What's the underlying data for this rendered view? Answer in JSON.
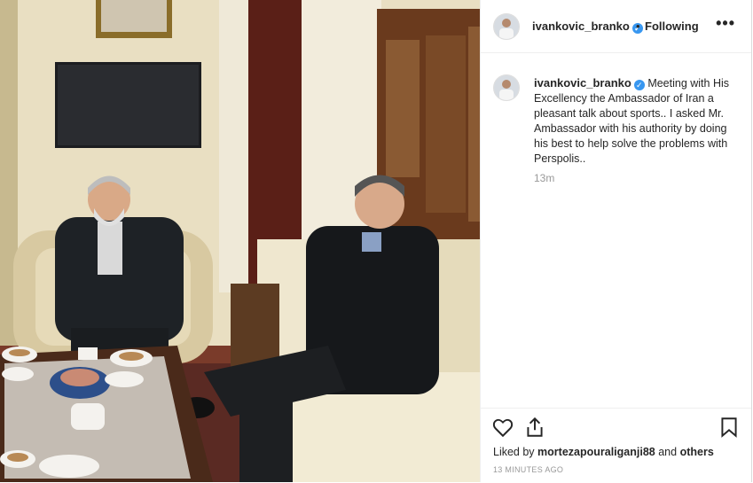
{
  "post": {
    "username": "ivankovic_branko",
    "verified_glyph": "✓",
    "separator": "•",
    "follow_status": "Following",
    "more_label": "•••",
    "caption_text": "Meeting with His Excellency the Ambassador of Iran a pleasant talk about sports.. I asked Mr. Ambassador with his authority by doing his best to help solve the problems with Perspolis..",
    "caption_time": "13m",
    "liked_prefix": "Liked by",
    "liked_user": "mortezapouraliganji88",
    "liked_and": "and",
    "liked_others": "others",
    "timestamp": "13 MINUTES AGO"
  },
  "icons": {
    "like": "heart-icon",
    "share": "share-icon",
    "save": "bookmark-icon",
    "more": "more-options-icon",
    "verified": "verified-badge-icon"
  },
  "colors": {
    "verified": "#3897f0",
    "text": "#262626",
    "muted": "#999999"
  }
}
